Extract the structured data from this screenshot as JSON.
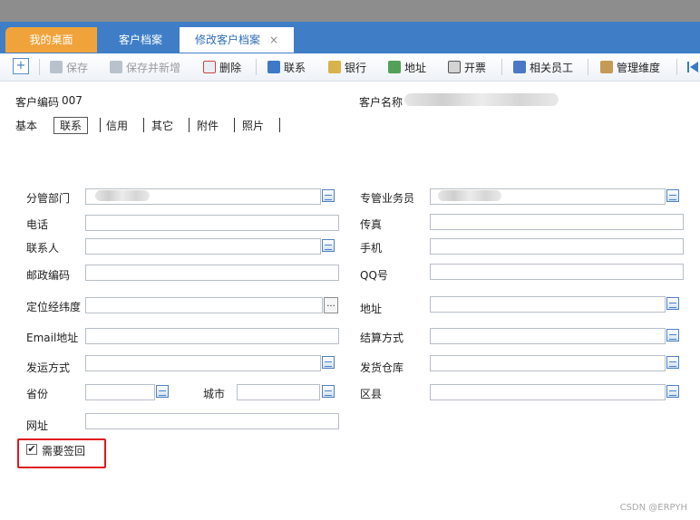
{
  "tabs": [
    {
      "label": "我的桌面"
    },
    {
      "label": "客户档案"
    },
    {
      "label": "修改客户档案",
      "close": "×"
    }
  ],
  "toolbar": {
    "plus": "+",
    "save": "保存",
    "save_new": "保存并新增",
    "delete": "删除",
    "contact": "联系",
    "bank": "银行",
    "address": "地址",
    "invoice": "开票",
    "staff": "相关员工",
    "dimension": "管理维度"
  },
  "customer": {
    "code_label": "客户编码",
    "code_value": "007",
    "name_label": "客户名称"
  },
  "subtabs": [
    "基本",
    "联系",
    "信用",
    "其它",
    "附件",
    "照片"
  ],
  "fields": {
    "dept": "分管部门",
    "phone": "电话",
    "contact_person": "联系人",
    "postal": "邮政编码",
    "geo": "定位经纬度",
    "email": "Email地址",
    "ship": "发运方式",
    "province": "省份",
    "city": "城市",
    "website": "网址",
    "salesman": "专管业务员",
    "fax": "传真",
    "mobile": "手机",
    "qq": "QQ号",
    "addr": "地址",
    "settle": "结算方式",
    "warehouse": "发货仓库",
    "district": "区县"
  },
  "geo_button": "...",
  "checkbox": {
    "label": "需要签回",
    "mark": "✔"
  },
  "watermark": "CSDN @ERPYH"
}
